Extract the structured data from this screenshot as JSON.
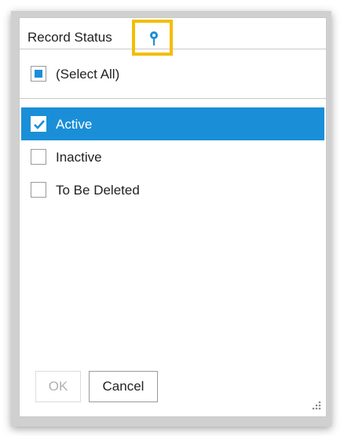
{
  "panel": {
    "title": "Record Status",
    "pin_icon": "pin-icon",
    "highlight_color": "#f5bd00",
    "accent_color": "#1a8fd8"
  },
  "select_all": {
    "label": "(Select All)",
    "state": "partial"
  },
  "items": [
    {
      "label": "Active",
      "checked": true,
      "selected": true
    },
    {
      "label": "Inactive",
      "checked": false,
      "selected": false
    },
    {
      "label": "To Be Deleted",
      "checked": false,
      "selected": false
    }
  ],
  "footer": {
    "ok_label": "OK",
    "ok_disabled": true,
    "cancel_label": "Cancel",
    "resize_icon": "resize-grip-icon"
  }
}
